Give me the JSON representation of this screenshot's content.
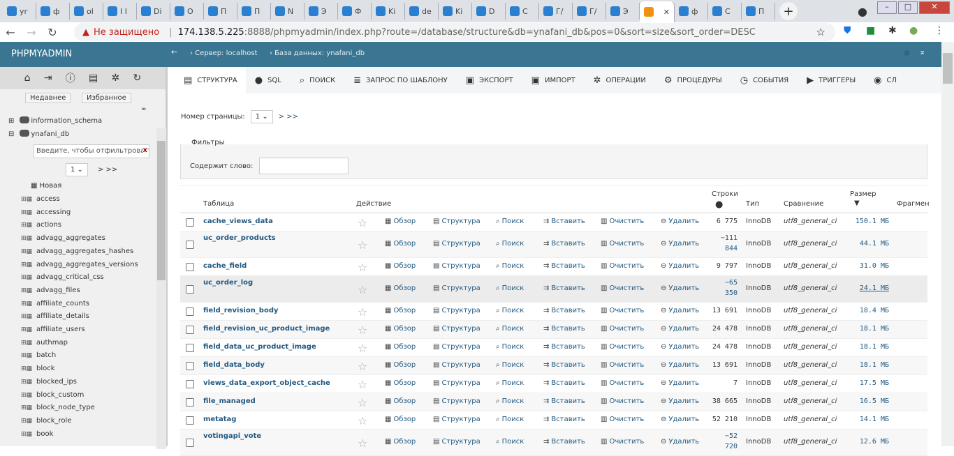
{
  "browser": {
    "tabs": [
      "уг",
      "ф",
      "ol",
      "I I",
      "Di",
      "O",
      "П",
      "П",
      "N",
      "Э",
      "Ф",
      "Ki",
      "de",
      "Ki",
      "D",
      "C",
      "Г/",
      "Г/",
      "Э",
      "",
      "ф",
      "C",
      "П"
    ],
    "active_tab_index": 19,
    "new_tab": "+",
    "address": {
      "warning": "Не защищено",
      "host": "174.138.5.225",
      "rest": ":8888/phpmyadmin/index.php?route=/database/structure&db=ynafani_db&pos=0&sort=size&sort_order=DESC"
    }
  },
  "header": {
    "logo": "PHPMYADMIN",
    "back": "←",
    "crumb_server": "› Сервер: localhost",
    "crumb_db": "› База данных: ynafani_db"
  },
  "sidebar": {
    "recent": "Недавнее",
    "favorites": "Избранное",
    "dbs": [
      "information_schema",
      "ynafani_db"
    ],
    "filter_placeholder": "Введите, чтобы отфильтровать",
    "page": "1",
    "page_next": "> >>",
    "new": "Новая",
    "tables": [
      "access",
      "accessing",
      "actions",
      "advagg_aggregates",
      "advagg_aggregates_hashes",
      "advagg_aggregates_versions",
      "advagg_critical_css",
      "advagg_files",
      "affiliate_counts",
      "affiliate_details",
      "affiliate_users",
      "authmap",
      "batch",
      "block",
      "blocked_ips",
      "block_custom",
      "block_node_type",
      "block_role",
      "book"
    ]
  },
  "tabs": [
    {
      "label": "СТРУКТУРА",
      "icon": "structure-icon"
    },
    {
      "label": "SQL",
      "icon": "play-icon"
    },
    {
      "label": "ПОИСК",
      "icon": "search-icon"
    },
    {
      "label": "ЗАПРОС ПО ШАБЛОНУ",
      "icon": "database-icon"
    },
    {
      "label": "ЭКСПОРТ",
      "icon": "export-icon"
    },
    {
      "label": "ИМПОРТ",
      "icon": "import-icon"
    },
    {
      "label": "ОПЕРАЦИИ",
      "icon": "gear-icon"
    },
    {
      "label": "ПРОЦЕДУРЫ",
      "icon": "routines-icon"
    },
    {
      "label": "СОБЫТИЯ",
      "icon": "clock-icon"
    },
    {
      "label": "ТРИГГЕРЫ",
      "icon": "triggers-icon"
    },
    {
      "label": "СЛ",
      "icon": "eye-icon"
    }
  ],
  "pager": {
    "label": "Номер страницы:",
    "value": "1",
    "next": "> >>"
  },
  "filters": {
    "legend": "Фильтры",
    "label": "Содержит слово:",
    "value": ""
  },
  "table": {
    "headers": {
      "table": "Таблица",
      "action": "Действие",
      "rows": "Строки",
      "type": "Тип",
      "collation": "Сравнение",
      "size": "Размер",
      "overhead": "Фрагмен"
    },
    "actions": [
      "Обзор",
      "Структура",
      "Поиск",
      "Вставить",
      "Очистить",
      "Удалить"
    ],
    "rows": [
      {
        "name": "cache_views_data",
        "rows": "6 775",
        "type": "InnoDB",
        "collation": "utf8_general_ci",
        "size": "150.1 МБ"
      },
      {
        "name": "uc_order_products",
        "rows": "~111 844",
        "type": "InnoDB",
        "collation": "utf8_general_ci",
        "size": "44.1 МБ"
      },
      {
        "name": "cache_field",
        "rows": "9 797",
        "type": "InnoDB",
        "collation": "utf8_general_ci",
        "size": "31.0 МБ"
      },
      {
        "name": "uc_order_log",
        "rows": "~65 350",
        "type": "InnoDB",
        "collation": "utf8_general_ci",
        "size": "24.1 МБ"
      },
      {
        "name": "field_revision_body",
        "rows": "13 691",
        "type": "InnoDB",
        "collation": "utf8_general_ci",
        "size": "18.4 МБ"
      },
      {
        "name": "field_revision_uc_product_image",
        "rows": "24 478",
        "type": "InnoDB",
        "collation": "utf8_general_ci",
        "size": "18.1 МБ"
      },
      {
        "name": "field_data_uc_product_image",
        "rows": "24 478",
        "type": "InnoDB",
        "collation": "utf8_general_ci",
        "size": "18.1 МБ"
      },
      {
        "name": "field_data_body",
        "rows": "13 691",
        "type": "InnoDB",
        "collation": "utf8_general_ci",
        "size": "18.1 МБ"
      },
      {
        "name": "views_data_export_object_cache",
        "rows": "7",
        "type": "InnoDB",
        "collation": "utf8_general_ci",
        "size": "17.5 МБ"
      },
      {
        "name": "file_managed",
        "rows": "38 665",
        "type": "InnoDB",
        "collation": "utf8_general_ci",
        "size": "16.5 МБ"
      },
      {
        "name": "metatag",
        "rows": "52 210",
        "type": "InnoDB",
        "collation": "utf8_general_ci",
        "size": "14.1 МБ"
      },
      {
        "name": "votingapi_vote",
        "rows": "~52 720",
        "type": "InnoDB",
        "collation": "utf8_general_ci",
        "size": "12.6 МБ"
      }
    ]
  }
}
